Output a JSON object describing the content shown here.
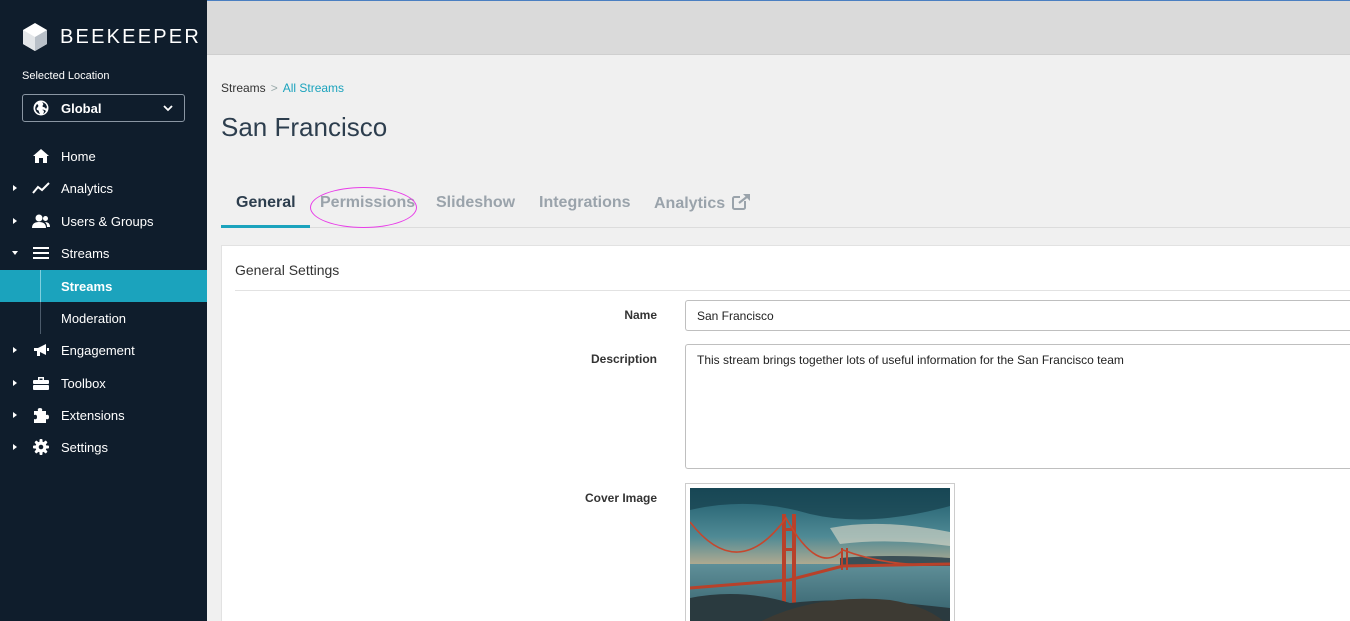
{
  "brand": {
    "name": "BEEKEEPER"
  },
  "location": {
    "label": "Selected Location",
    "value": "Global"
  },
  "nav": {
    "items": [
      {
        "label": "Home",
        "icon": "home-icon"
      },
      {
        "label": "Analytics",
        "icon": "trend-icon"
      },
      {
        "label": "Users & Groups",
        "icon": "users-icon"
      },
      {
        "label": "Streams",
        "icon": "menu-lines-icon"
      },
      {
        "label": "Engagement",
        "icon": "megaphone-icon"
      },
      {
        "label": "Toolbox",
        "icon": "toolbox-icon"
      },
      {
        "label": "Extensions",
        "icon": "puzzle-icon"
      },
      {
        "label": "Settings",
        "icon": "gear-icon"
      }
    ],
    "streams_sub": [
      {
        "label": "Streams",
        "active": true
      },
      {
        "label": "Moderation",
        "active": false
      }
    ]
  },
  "breadcrumb": {
    "root": "Streams",
    "separator": ">",
    "current": "All Streams"
  },
  "page": {
    "title": "San Francisco"
  },
  "tabs": [
    {
      "label": "General",
      "active": true
    },
    {
      "label": "Permissions",
      "highlighted": true
    },
    {
      "label": "Slideshow"
    },
    {
      "label": "Integrations"
    },
    {
      "label": "Analytics",
      "icon": "external-link-icon"
    }
  ],
  "general": {
    "section_title": "General Settings",
    "name_label": "Name",
    "name_value": "San Francisco",
    "description_label": "Description",
    "description_value": "This stream brings together lots of useful information for the San Francisco team",
    "cover_label": "Cover Image",
    "cover_image": "golden-gate-bridge-photo"
  },
  "colors": {
    "sidebar_bg": "#0f1d2c",
    "accent": "#1ba3bd",
    "highlight_ellipse": "#e83ee8"
  }
}
